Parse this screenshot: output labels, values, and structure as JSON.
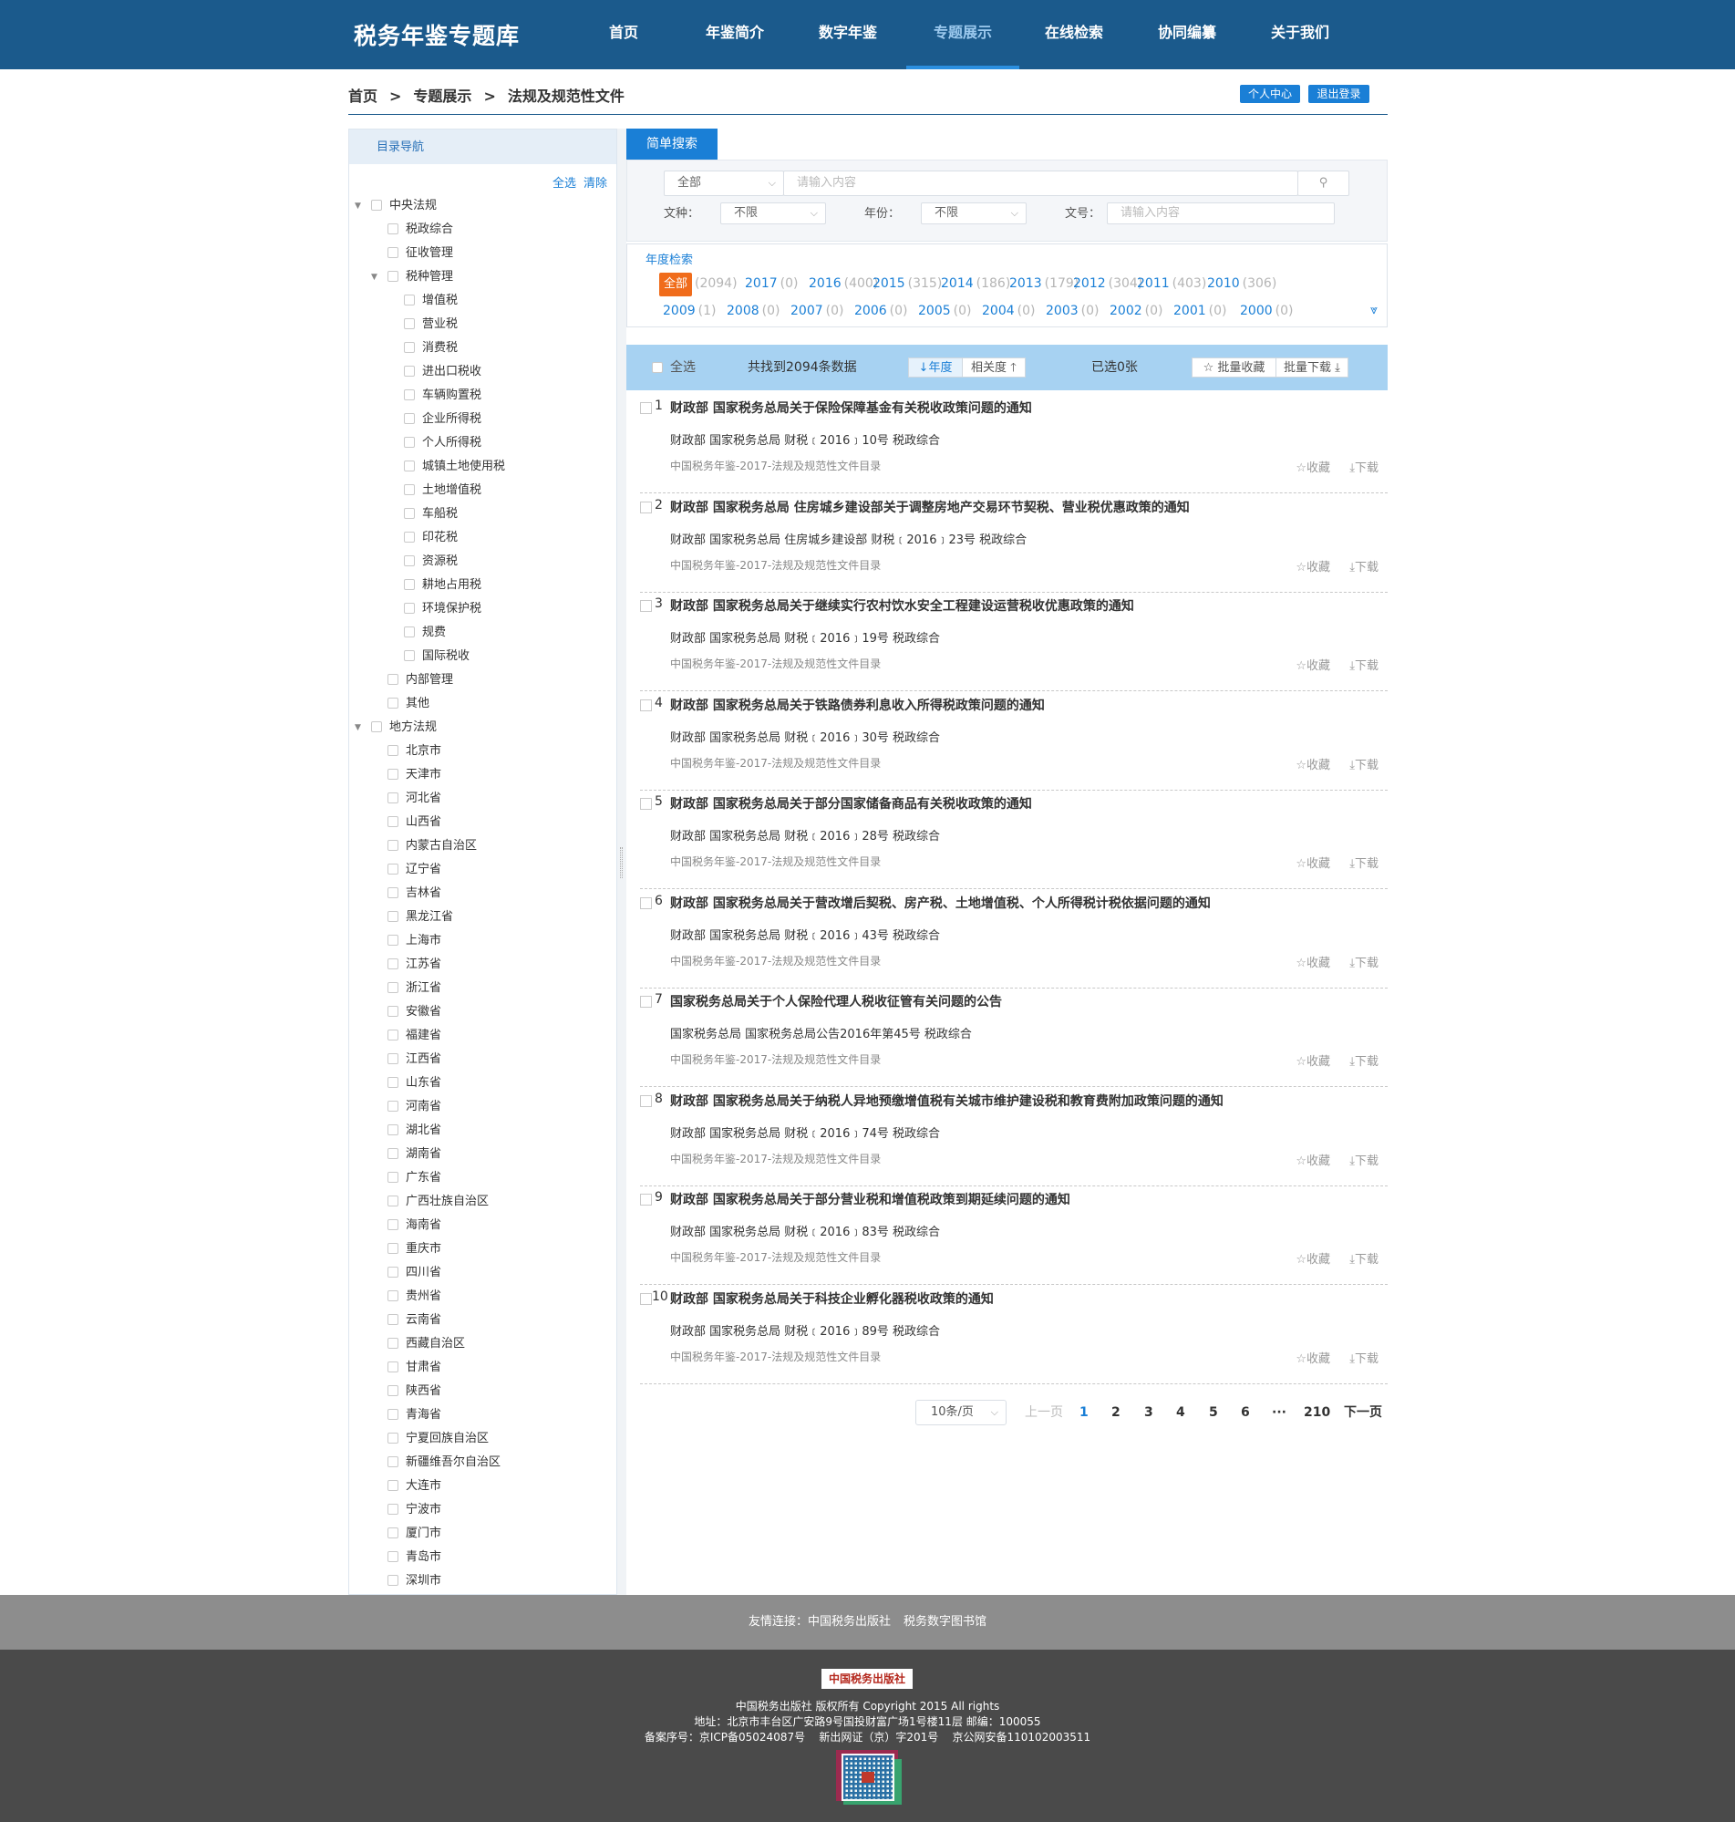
{
  "header": {
    "logo": "税务年鉴专题库",
    "nav": [
      "首页",
      "年鉴简介",
      "数字年鉴",
      "专题展示",
      "在线检索",
      "协同编纂",
      "关于我们"
    ],
    "active_nav": "专题展示"
  },
  "breadcrumb": {
    "items": [
      "首页",
      "专题展示",
      "法规及规范性文件"
    ],
    "separator": ">"
  },
  "user_actions": {
    "personal_center": "个人中心",
    "logout": "退出登录"
  },
  "sidebar": {
    "title": "目录导航",
    "select_all": "全选",
    "clear": "清除",
    "tree": [
      {
        "label": "中央法规",
        "level": 0,
        "expanded": true
      },
      {
        "label": "税政综合",
        "level": 1
      },
      {
        "label": "征收管理",
        "level": 1
      },
      {
        "label": "税种管理",
        "level": 1,
        "expanded": true
      },
      {
        "label": "增值税",
        "level": 2
      },
      {
        "label": "营业税",
        "level": 2
      },
      {
        "label": "消费税",
        "level": 2
      },
      {
        "label": "进出口税收",
        "level": 2
      },
      {
        "label": "车辆购置税",
        "level": 2
      },
      {
        "label": "企业所得税",
        "level": 2
      },
      {
        "label": "个人所得税",
        "level": 2
      },
      {
        "label": "城镇土地使用税",
        "level": 2
      },
      {
        "label": "土地增值税",
        "level": 2
      },
      {
        "label": "车船税",
        "level": 2
      },
      {
        "label": "印花税",
        "level": 2
      },
      {
        "label": "资源税",
        "level": 2
      },
      {
        "label": "耕地占用税",
        "level": 2
      },
      {
        "label": "环境保护税",
        "level": 2
      },
      {
        "label": "规费",
        "level": 2
      },
      {
        "label": "国际税收",
        "level": 2
      },
      {
        "label": "内部管理",
        "level": 1
      },
      {
        "label": "其他",
        "level": 1
      },
      {
        "label": "地方法规",
        "level": 0,
        "expanded": true
      },
      {
        "label": "北京市",
        "level": 1
      },
      {
        "label": "天津市",
        "level": 1
      },
      {
        "label": "河北省",
        "level": 1
      },
      {
        "label": "山西省",
        "level": 1
      },
      {
        "label": "内蒙古自治区",
        "level": 1
      },
      {
        "label": "辽宁省",
        "level": 1
      },
      {
        "label": "吉林省",
        "level": 1
      },
      {
        "label": "黑龙江省",
        "level": 1
      },
      {
        "label": "上海市",
        "level": 1
      },
      {
        "label": "江苏省",
        "level": 1
      },
      {
        "label": "浙江省",
        "level": 1
      },
      {
        "label": "安徽省",
        "level": 1
      },
      {
        "label": "福建省",
        "level": 1
      },
      {
        "label": "江西省",
        "level": 1
      },
      {
        "label": "山东省",
        "level": 1
      },
      {
        "label": "河南省",
        "level": 1
      },
      {
        "label": "湖北省",
        "level": 1
      },
      {
        "label": "湖南省",
        "level": 1
      },
      {
        "label": "广东省",
        "level": 1
      },
      {
        "label": "广西壮族自治区",
        "level": 1
      },
      {
        "label": "海南省",
        "level": 1
      },
      {
        "label": "重庆市",
        "level": 1
      },
      {
        "label": "四川省",
        "level": 1
      },
      {
        "label": "贵州省",
        "level": 1
      },
      {
        "label": "云南省",
        "level": 1
      },
      {
        "label": "西藏自治区",
        "level": 1
      },
      {
        "label": "甘肃省",
        "level": 1
      },
      {
        "label": "陕西省",
        "level": 1
      },
      {
        "label": "青海省",
        "level": 1
      },
      {
        "label": "宁夏回族自治区",
        "level": 1
      },
      {
        "label": "新疆维吾尔自治区",
        "level": 1
      },
      {
        "label": "大连市",
        "level": 1
      },
      {
        "label": "宁波市",
        "level": 1
      },
      {
        "label": "厦门市",
        "level": 1
      },
      {
        "label": "青岛市",
        "level": 1
      },
      {
        "label": "深圳市",
        "level": 1
      }
    ]
  },
  "search": {
    "tab": "简单搜索",
    "scope": "全部",
    "query_placeholder": "请输入内容",
    "doc_type_label": "文种：",
    "doc_type_value": "不限",
    "year_label": "年份：",
    "year_value": "不限",
    "doc_no_label": "文号：",
    "doc_no_placeholder": "请输入内容"
  },
  "year_filter": {
    "tab": "年度检索",
    "all_label": "全部",
    "all_count": "(2094)",
    "row1": [
      {
        "year": "2017",
        "count": "(0)"
      },
      {
        "year": "2016",
        "count": "(400)"
      },
      {
        "year": "2015",
        "count": "(315)"
      },
      {
        "year": "2014",
        "count": "(186)"
      },
      {
        "year": "2013",
        "count": "(179)"
      },
      {
        "year": "2012",
        "count": "(304)"
      },
      {
        "year": "2011",
        "count": "(403)"
      },
      {
        "year": "2010",
        "count": "(306)"
      }
    ],
    "row2": [
      {
        "year": "2009",
        "count": "(1)"
      },
      {
        "year": "2008",
        "count": "(0)"
      },
      {
        "year": "2007",
        "count": "(0)"
      },
      {
        "year": "2006",
        "count": "(0)"
      },
      {
        "year": "2005",
        "count": "(0)"
      },
      {
        "year": "2004",
        "count": "(0)"
      },
      {
        "year": "2003",
        "count": "(0)"
      },
      {
        "year": "2002",
        "count": "(0)"
      },
      {
        "year": "2001",
        "count": "(0)"
      },
      {
        "year": "2000",
        "count": "(0)"
      }
    ]
  },
  "toolbar": {
    "select_all": "全选",
    "found": "共找到2094条数据",
    "sort_year": "↓年度",
    "sort_relevance": "相关度 🡑",
    "selected": "已选0张",
    "batch_fav": "☆ 批量收藏",
    "batch_download": "批量下载 ⤓"
  },
  "results": [
    {
      "num": "1",
      "title": "财政部 国家税务总局关于保险保障基金有关税收政策问题的通知",
      "meta": "财政部 国家税务总局 财税﹝2016﹞10号 税政综合",
      "source": "中国税务年鉴-2017-法规及规范性文件目录"
    },
    {
      "num": "2",
      "title": "财政部 国家税务总局 住房城乡建设部关于调整房地产交易环节契税、营业税优惠政策的通知",
      "meta": "财政部 国家税务总局 住房城乡建设部 财税﹝2016﹞23号 税政综合",
      "source": "中国税务年鉴-2017-法规及规范性文件目录"
    },
    {
      "num": "3",
      "title": "财政部 国家税务总局关于继续实行农村饮水安全工程建设运营税收优惠政策的通知",
      "meta": "财政部 国家税务总局 财税﹝2016﹞19号 税政综合",
      "source": "中国税务年鉴-2017-法规及规范性文件目录"
    },
    {
      "num": "4",
      "title": "财政部 国家税务总局关于铁路债券利息收入所得税政策问题的通知",
      "meta": "财政部 国家税务总局 财税﹝2016﹞30号 税政综合",
      "source": "中国税务年鉴-2017-法规及规范性文件目录"
    },
    {
      "num": "5",
      "title": "财政部 国家税务总局关于部分国家储备商品有关税收政策的通知",
      "meta": "财政部 国家税务总局 财税﹝2016﹞28号 税政综合",
      "source": "中国税务年鉴-2017-法规及规范性文件目录"
    },
    {
      "num": "6",
      "title": "财政部 国家税务总局关于营改增后契税、房产税、土地增值税、个人所得税计税依据问题的通知",
      "meta": "财政部 国家税务总局 财税﹝2016﹞43号 税政综合",
      "source": "中国税务年鉴-2017-法规及规范性文件目录"
    },
    {
      "num": "7",
      "title": "国家税务总局关于个人保险代理人税收征管有关问题的公告",
      "meta": "国家税务总局 国家税务总局公告2016年第45号 税政综合",
      "source": "中国税务年鉴-2017-法规及规范性文件目录"
    },
    {
      "num": "8",
      "title": "财政部 国家税务总局关于纳税人异地预缴增值税有关城市维护建设税和教育费附加政策问题的通知",
      "meta": "财政部 国家税务总局 财税﹝2016﹞74号 税政综合",
      "source": "中国税务年鉴-2017-法规及规范性文件目录"
    },
    {
      "num": "9",
      "title": "财政部 国家税务总局关于部分营业税和增值税政策到期延续问题的通知",
      "meta": "财政部 国家税务总局 财税﹝2016﹞83号 税政综合",
      "source": "中国税务年鉴-2017-法规及规范性文件目录"
    },
    {
      "num": "10",
      "title": "财政部 国家税务总局关于科技企业孵化器税收政策的通知",
      "meta": "财政部 国家税务总局 财税﹝2016﹞89号 税政综合",
      "source": "中国税务年鉴-2017-法规及规范性文件目录"
    }
  ],
  "result_actions": {
    "favorite": "☆收藏",
    "download": "⤓下载"
  },
  "pagination": {
    "page_size": "10条/页",
    "prev": "上一页",
    "pages": [
      "1",
      "2",
      "3",
      "4",
      "5",
      "6"
    ],
    "ellipsis": "···",
    "last": "210",
    "next": "下一页",
    "current": "1"
  },
  "footer": {
    "links_label": "友情连接：",
    "links": [
      "中国税务出版社",
      "税务数字图书馆"
    ],
    "logo_text": "中国税务出版社",
    "copyright": "中国税务出版社 版权所有 Copyright 2015 All rights",
    "address": "地址：北京市丰台区广安路9号国投财富广场1号楼11层 邮编：100055",
    "icp": "备案序号：京ICP备05024087号    新出网证（京）字201号    京公网安备110102003511"
  },
  "colors": {
    "header": "#1b5a8c",
    "accent": "#1a7fd6",
    "year_all": "#f06c1b",
    "toolbar": "#a7d2f2"
  }
}
